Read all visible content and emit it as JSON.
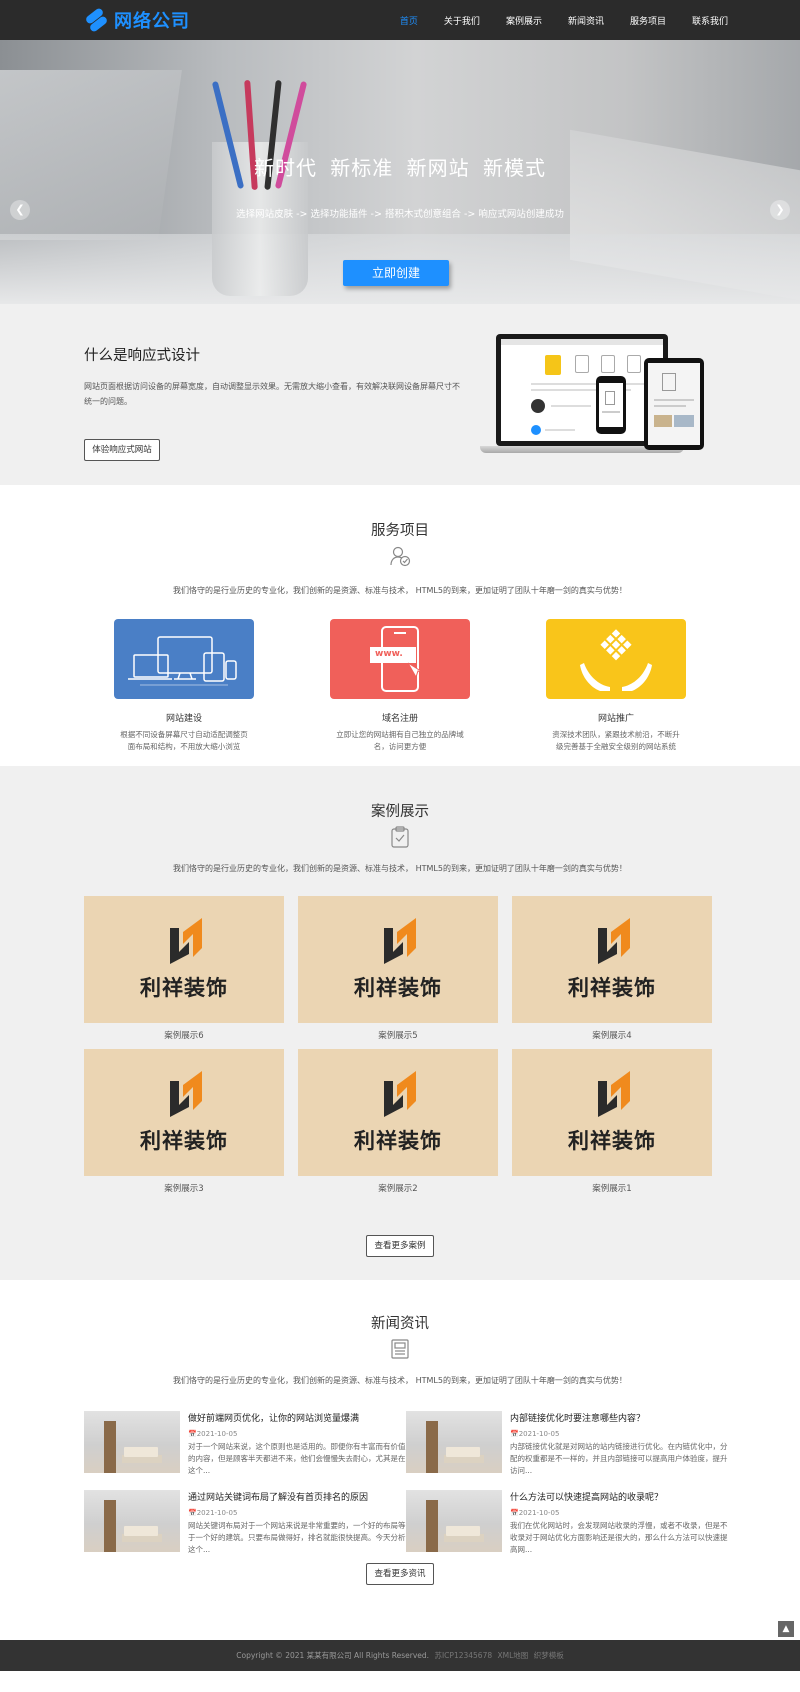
{
  "header": {
    "logo_text": "网络公司",
    "nav": [
      {
        "label": "首页",
        "active": true
      },
      {
        "label": "关于我们",
        "active": false
      },
      {
        "label": "案例展示",
        "active": false
      },
      {
        "label": "新闻资讯",
        "active": false
      },
      {
        "label": "服务项目",
        "active": false
      },
      {
        "label": "联系我们",
        "active": false
      }
    ],
    "accent_color": "#1e90ff"
  },
  "banner": {
    "title": "新时代 新标准 新网站 新模式",
    "subtitle": "选择网站皮肤 -> 选择功能插件 -> 搭积木式创意组合 -> 响应式网站创建成功",
    "button": "立即创建",
    "prev_icon": "chevron-left-icon",
    "next_icon": "chevron-right-icon"
  },
  "intro": {
    "title": "什么是响应式设计",
    "text": "网站页面根据访问设备的屏幕宽度，自动调整显示效果。无需放大缩小查看，有效解决联网设备屏幕尺寸不统一的问题。",
    "button": "体验响应式网站"
  },
  "services": {
    "title": "服务项目",
    "desc": "我们恪守的是行业历史的专业化，我们创新的是资源、标准与技术， HTML5的到来，更加证明了团队十年磨一剑的真实与优势！",
    "items": [
      {
        "name": "网站建设",
        "text": "根据不同设备屏幕尺寸自动适配调整页面布局和结构，不用放大缩小浏览",
        "color": "#4a7fc6"
      },
      {
        "name": "域名注册",
        "text": "立即让您的网站拥有自己独立的品牌域名，访问更方便",
        "color": "#f0605a",
        "badge": "www."
      },
      {
        "name": "网站推广",
        "text": "资深技术团队，紧跟技术前沿，不断升级完善基于全融安全级别的网站系统",
        "color": "#f9c51a"
      }
    ]
  },
  "cases": {
    "title": "案例展示",
    "desc": "我们恪守的是行业历史的专业化，我们创新的是资源、标准与技术， HTML5的到来，更加证明了团队十年磨一剑的真实与优势！",
    "logo_text": "利祥装饰",
    "items": [
      {
        "caption": "案例展示6"
      },
      {
        "caption": "案例展示5"
      },
      {
        "caption": "案例展示4"
      },
      {
        "caption": "案例展示3"
      },
      {
        "caption": "案例展示2"
      },
      {
        "caption": "案例展示1"
      }
    ],
    "more_button": "查看更多案例"
  },
  "news": {
    "title": "新闻资讯",
    "desc": "我们恪守的是行业历史的专业化，我们创新的是资源、标准与技术， HTML5的到来，更加证明了团队十年磨一剑的真实与优势！",
    "items": [
      {
        "title": "做好前端网页优化，让你的网站浏览量爆满",
        "date": "2021-10-05",
        "summary": "对于一个网站来说，这个原则也是适用的。即便你有丰富而有价值的内容，但是顾客半天都进不来，他们会慢慢失去耐心，尤其是在这个..."
      },
      {
        "title": "内部链接优化时要注意哪些内容？",
        "date": "2021-10-05",
        "summary": "内部链接优化就是对网站的站内链接进行优化。在内链优化中，分配的权重都是不一样的，并且内部链接可以提高用户体验度，提升访问..."
      },
      {
        "title": "通过网站关键词布局了解没有首页排名的原因",
        "date": "2021-10-05",
        "summary": "网站关键词布局对于一个网站来说是非常重要的，一个好的布局等于一个好的建筑。只要布局做得好，排名就能很快提高。今天分析这个..."
      },
      {
        "title": "什么方法可以快速提高网站的收录呢？",
        "date": "2021-10-05",
        "summary": "我们在优化网站时，会发现网站收录的浮慢，或者不收录，但是不收录对于网站优化方面影响还是很大的，那么什么方法可以快速提高网..."
      }
    ],
    "more_button": "查看更多资讯"
  },
  "footer": {
    "copyright": "Copyright © 2021 某某有限公司 All Rights Reserved.",
    "icp": "苏ICP12345678",
    "links": [
      "XML地图",
      "织梦模板"
    ],
    "to_top_icon": "arrow-up-icon"
  }
}
